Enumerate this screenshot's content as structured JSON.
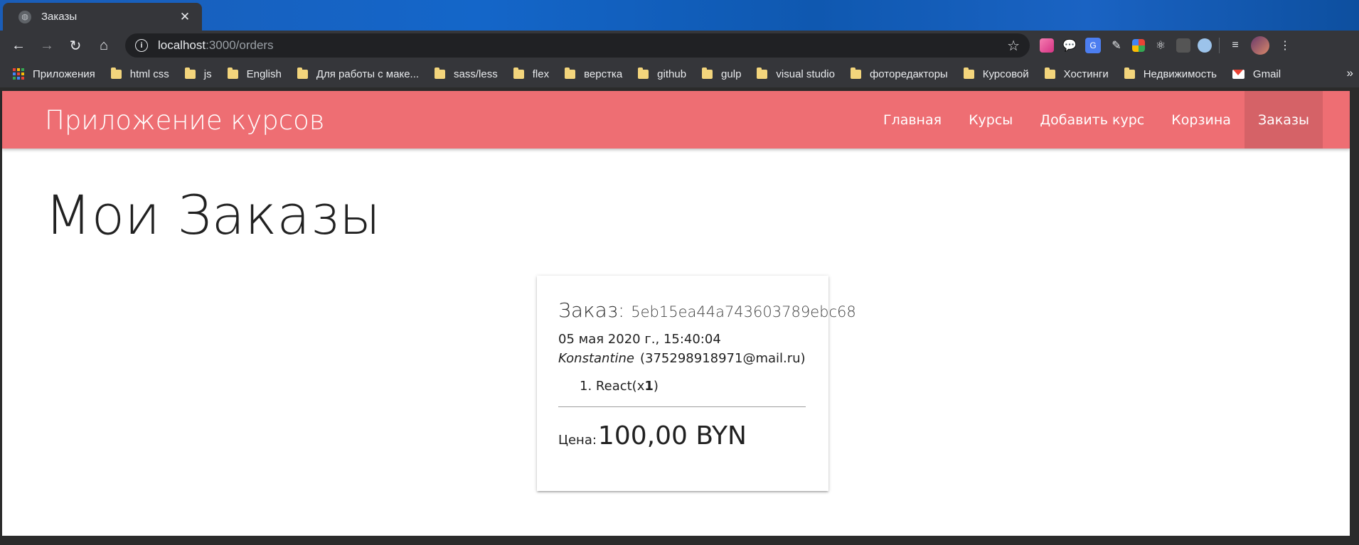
{
  "tab": {
    "title": "Заказы",
    "close": "✕"
  },
  "address": {
    "host": "localhost",
    "path": ":3000/orders"
  },
  "bookmarks": [
    "Приложения",
    "html css",
    "js",
    "English",
    "Для работы с маке...",
    "sass/less",
    "flex",
    "верстка",
    "github",
    "gulp",
    "visual studio",
    "фоторедакторы",
    "Курсовой",
    "Хостинги",
    "Недвижимость",
    "Gmail"
  ],
  "navbar": {
    "brand": "Приложение курсов",
    "links": [
      "Главная",
      "Курсы",
      "Добавить курс",
      "Корзина",
      "Заказы"
    ],
    "active": "Заказы"
  },
  "page": {
    "title": "Мои Заказы"
  },
  "order": {
    "label": "Заказ:",
    "id": "5eb15ea44a743603789ebc68",
    "date": "05 мая 2020 г., 15:40:04",
    "user_name": "Konstantine",
    "user_email": "(375298918971@mail.ru)",
    "items": [
      {
        "index": "1.",
        "name": "React(x",
        "qty": "1",
        "close": ")"
      }
    ],
    "price_label": "Цена:",
    "price_value": "100,00 BYN"
  },
  "colors": {
    "navbar": "#ee6e73",
    "tabstrip": "#1466c9"
  },
  "icons": [
    "back-arrow-icon",
    "forward-arrow-icon",
    "reload-icon",
    "home-icon",
    "info-icon",
    "star-icon",
    "folder-icon",
    "apps-icon",
    "gmail-icon"
  ]
}
